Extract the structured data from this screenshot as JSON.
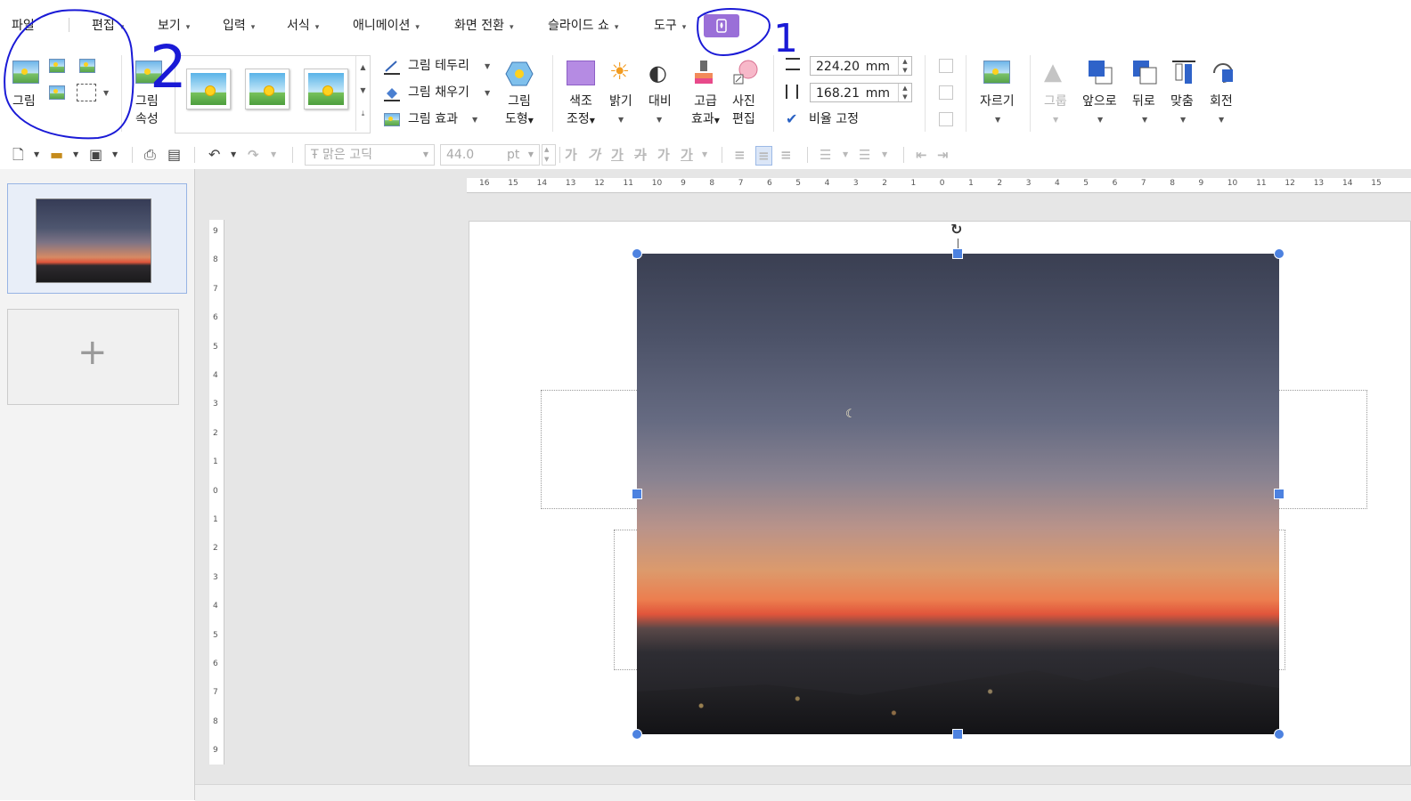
{
  "menu": {
    "items": [
      {
        "label": "파일",
        "caret": false
      },
      {
        "label": "편집",
        "caret": true
      },
      {
        "label": "보기",
        "caret": true
      },
      {
        "label": "입력",
        "caret": true
      },
      {
        "label": "서식",
        "caret": true
      },
      {
        "label": "애니메이션",
        "caret": true
      },
      {
        "label": "화면 전환",
        "caret": true
      },
      {
        "label": "슬라이드 쇼",
        "caret": true
      },
      {
        "label": "도구",
        "caret": true
      }
    ],
    "caret_glyph": "▾",
    "mobile_icon": "phone-icon"
  },
  "ribbon": {
    "picture": "그림",
    "picture_props": [
      "그림",
      "속성"
    ],
    "border": "그림 테두리",
    "fill": "그림 채우기",
    "effect": "그림 효과",
    "shape": [
      "그림",
      "도형"
    ],
    "color_adjust": [
      "색조",
      "조정"
    ],
    "brightness": "밝기",
    "contrast": "대비",
    "advanced": [
      "고급",
      "효과"
    ],
    "photo_edit": [
      "사진",
      "편집"
    ],
    "width": {
      "value": "224.20",
      "unit": "mm"
    },
    "height": {
      "value": "168.21",
      "unit": "mm"
    },
    "lock_ratio": "비율 고정",
    "lock_ratio_checked": true,
    "crop": "자르기",
    "group": "그룹",
    "forward": "앞으로",
    "backward": "뒤로",
    "align": "맞춤",
    "rotate": "회전"
  },
  "toolbar": {
    "font_name": "맑은 고딕",
    "font_size": "44.0",
    "font_unit": "pt",
    "text_style_glyphs": [
      "가",
      "가",
      "가",
      "가",
      "가",
      "가"
    ]
  },
  "hruler_labels": [
    "16",
    "15",
    "14",
    "13",
    "12",
    "11",
    "10",
    "9",
    "8",
    "7",
    "6",
    "5",
    "4",
    "3",
    "2",
    "1",
    "0",
    "1",
    "2",
    "3",
    "4",
    "5",
    "6",
    "7",
    "8",
    "9",
    "10",
    "11",
    "12",
    "13",
    "14",
    "15"
  ],
  "vruler_labels": [
    "9",
    "8",
    "7",
    "6",
    "5",
    "4",
    "3",
    "2",
    "1",
    "0",
    "1",
    "2",
    "3",
    "4",
    "5",
    "6",
    "7",
    "8",
    "9"
  ],
  "slide_panel": {
    "add_label": "+"
  },
  "annotations": {
    "labels": [
      "1",
      "2"
    ],
    "color": "#1a1ad6"
  },
  "colors": {
    "accent": "#4d82e0",
    "mobile_button": "#9a6fd8"
  }
}
